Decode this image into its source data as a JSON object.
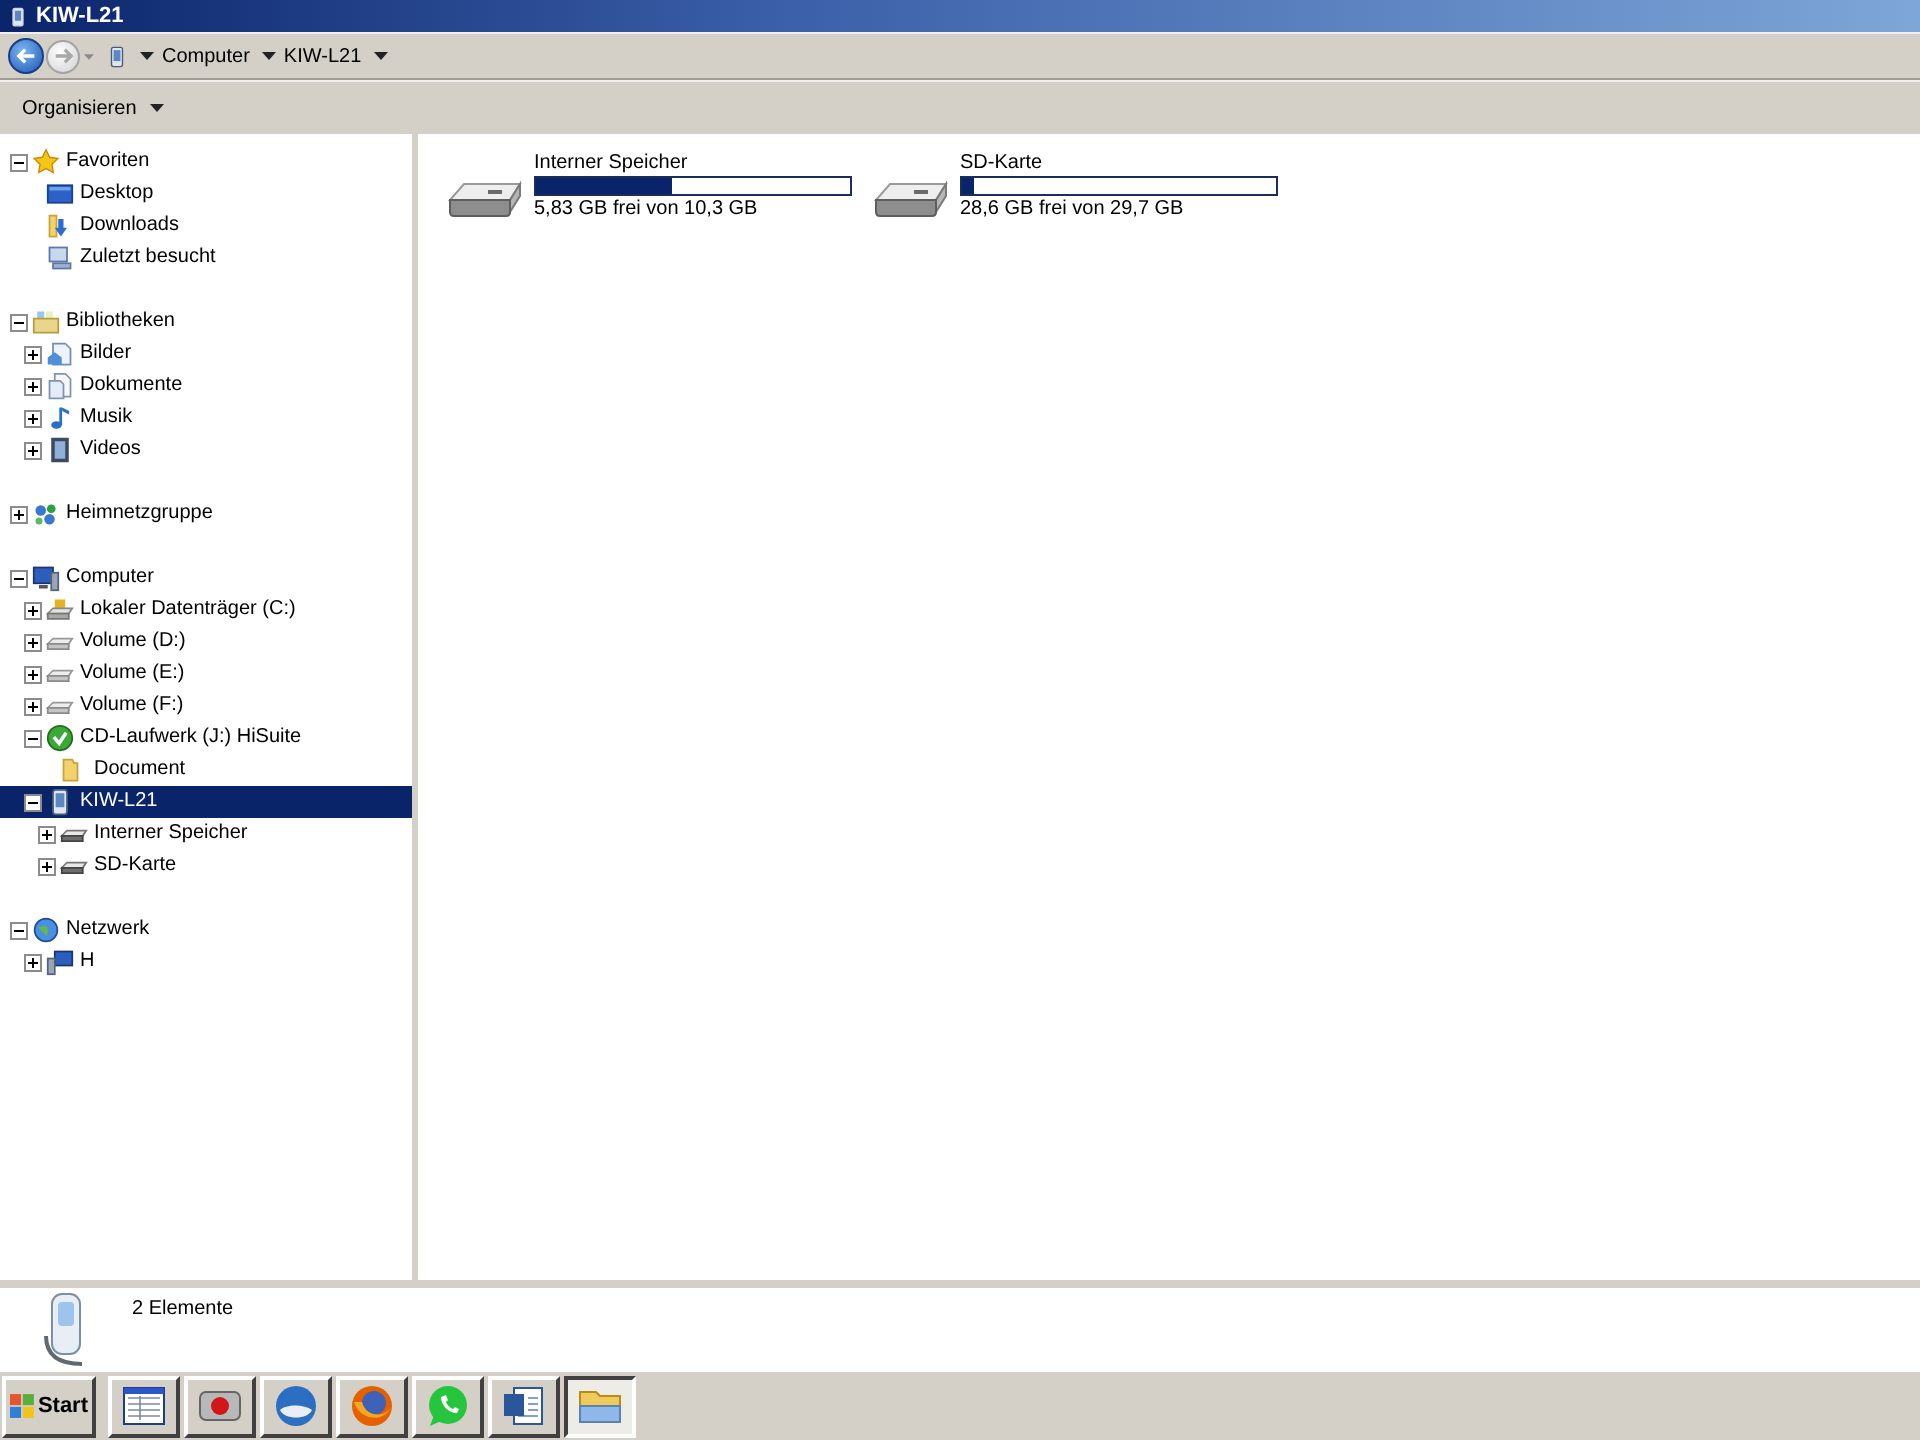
{
  "window": {
    "title": "KIW-L21"
  },
  "navigation": {
    "buttons": [
      {
        "kind": "back",
        "disabled": false
      },
      {
        "kind": "forward",
        "disabled": true
      }
    ],
    "breadcrumb": [
      "Computer",
      "KIW-L21"
    ]
  },
  "toolbar": {
    "menu": "Organisieren"
  },
  "sidebar": {
    "tree": [
      {
        "label": "Favoriten",
        "kind": "favorites",
        "expanded": true,
        "selected": false,
        "children": [
          {
            "label": "Desktop",
            "kind": "desktop",
            "selected": false
          },
          {
            "label": "Downloads",
            "kind": "downloads",
            "selected": false
          },
          {
            "label": "Zuletzt besucht",
            "kind": "recent",
            "selected": false
          }
        ]
      },
      {
        "label": "Bibliotheken",
        "kind": "libraries",
        "expanded": true,
        "selected": false,
        "children": [
          {
            "label": "Bilder",
            "kind": "pictures",
            "expanded": false,
            "selected": false
          },
          {
            "label": "Dokumente",
            "kind": "documents",
            "expanded": false,
            "selected": false
          },
          {
            "label": "Musik",
            "kind": "music",
            "expanded": false,
            "selected": false
          },
          {
            "label": "Videos",
            "kind": "videos",
            "expanded": false,
            "selected": false
          }
        ]
      },
      {
        "label": "Heimnetzgruppe",
        "kind": "homegroup",
        "expanded": false,
        "selected": false
      },
      {
        "label": "Computer",
        "kind": "computer",
        "expanded": true,
        "selected": false,
        "children": [
          {
            "label": "Lokaler Datenträger (C:)",
            "kind": "system-drive",
            "expanded": false,
            "selected": false
          },
          {
            "label": "Volume (D:)",
            "kind": "drive",
            "expanded": false,
            "selected": false
          },
          {
            "label": "Volume (E:)",
            "kind": "drive",
            "expanded": false,
            "selected": false
          },
          {
            "label": "Volume (F:)",
            "kind": "drive",
            "expanded": false,
            "selected": false
          },
          {
            "label": "CD-Laufwerk (J:) HiSuite",
            "kind": "disc",
            "expanded": true,
            "selected": false,
            "children": [
              {
                "label": "Document",
                "kind": "folder",
                "selected": false
              }
            ]
          },
          {
            "label": "KIW-L21",
            "kind": "phone",
            "expanded": true,
            "selected": true,
            "children": [
              {
                "label": "Interner Speicher",
                "kind": "storage",
                "expanded": false,
                "selected": false
              },
              {
                "label": "SD-Karte",
                "kind": "storage",
                "expanded": false,
                "selected": false
              }
            ]
          }
        ]
      },
      {
        "label": "Netzwerk",
        "kind": "network",
        "expanded": true,
        "selected": false,
        "children": [
          {
            "label": "H",
            "kind": "pc",
            "expanded": false,
            "selected": false
          }
        ]
      }
    ]
  },
  "content": {
    "drives": [
      {
        "name": "Interner Speicher",
        "level": 0.43,
        "free_space": "5,83 GB frei von 10,3 GB"
      },
      {
        "name": "SD-Karte",
        "level": 0.04,
        "free_space": "28,6 GB frei von 29,7 GB"
      }
    ]
  },
  "status_bar": {
    "text": "2 Elemente"
  },
  "taskbar": {
    "start": "Start",
    "apps": [
      {
        "kind": "sheet",
        "selected": false
      },
      {
        "kind": "camera",
        "selected": false
      },
      {
        "kind": "mail",
        "selected": false
      },
      {
        "kind": "browser",
        "selected": false
      },
      {
        "kind": "chat",
        "selected": false
      },
      {
        "kind": "word",
        "selected": false
      },
      {
        "kind": "explorer",
        "selected": true
      }
    ]
  }
}
